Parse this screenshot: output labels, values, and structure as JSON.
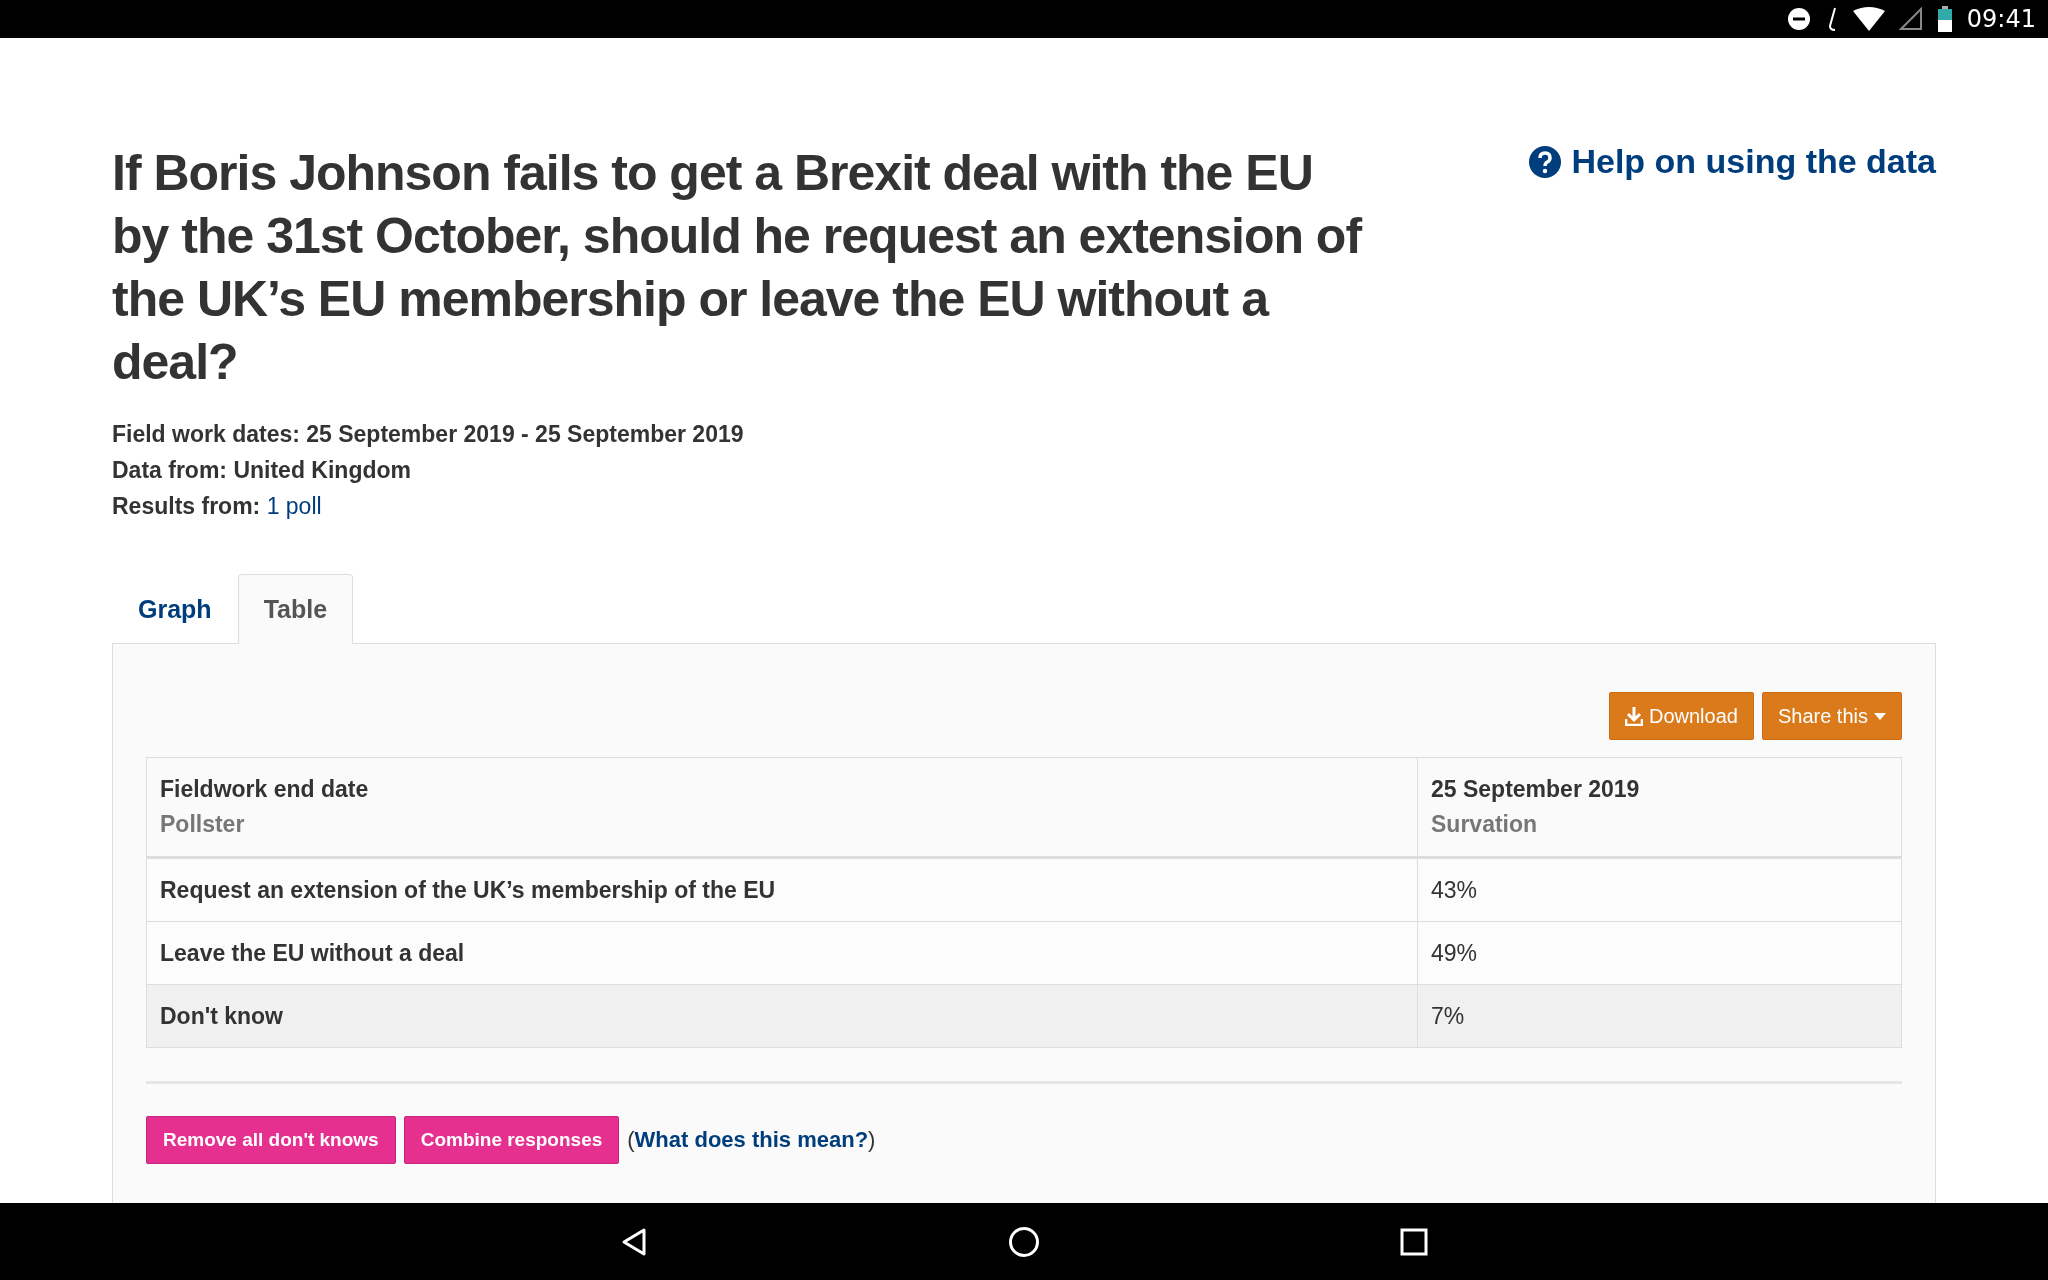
{
  "status_bar": {
    "time": "09:41"
  },
  "help_link": "Help on using the data",
  "title": "If Boris Johnson fails to get a Brexit deal with the EU by the 31st October, should he request an extension of the UK’s EU membership or leave the EU without a deal?",
  "meta": [
    {
      "label": "Field work dates:",
      "value": "25 September 2019 - 25 September 2019",
      "link": false
    },
    {
      "label": "Data from:",
      "value": "United Kingdom",
      "link": false
    },
    {
      "label": "Results from:",
      "value": "1 poll",
      "link": true
    }
  ],
  "tabs": [
    {
      "label": "Graph",
      "selected": false
    },
    {
      "label": "Table",
      "selected": true
    }
  ],
  "actions": [
    {
      "label": "Download",
      "kind": "download"
    },
    {
      "label": "Share this",
      "kind": "dropdown"
    }
  ],
  "table": {
    "header": {
      "label": "Fieldwork end date",
      "sublabel": "Pollster",
      "value": "25 September 2019",
      "subvalue": "Survation"
    },
    "rows": [
      {
        "label": "Request an extension of the UK’s membership of the EU",
        "value": "43%",
        "shaded": false
      },
      {
        "label": "Leave the EU without a deal",
        "value": "49%",
        "shaded": false
      },
      {
        "label": "Don't know",
        "value": "7%",
        "shaded": true
      }
    ]
  },
  "bottom_buttons": [
    "Remove all don't knows",
    "Combine responses"
  ],
  "explain": {
    "open": "(",
    "link": "What does this mean?",
    "close": ")"
  }
}
